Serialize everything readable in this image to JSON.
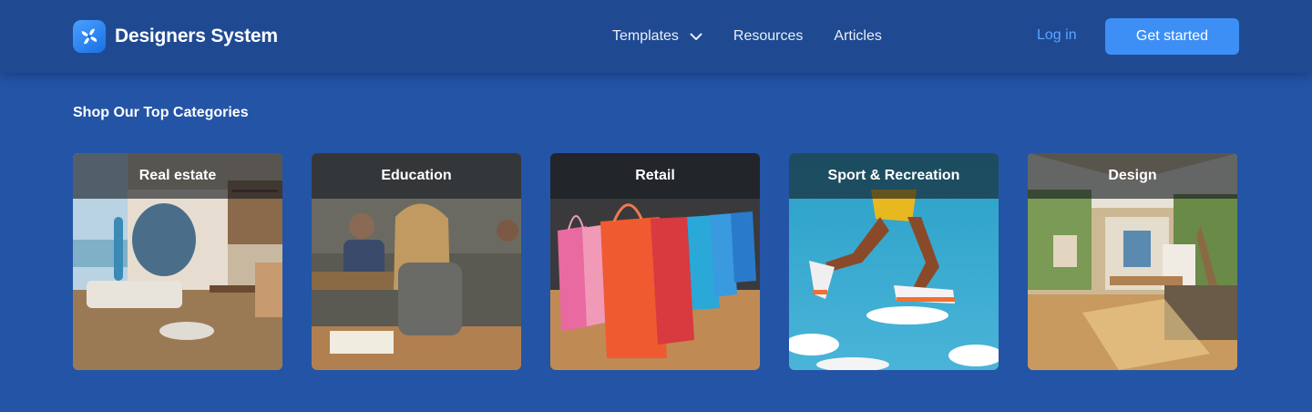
{
  "brand": {
    "name": "Designers System",
    "icon": "pinwheel-logo-icon"
  },
  "nav": {
    "links": [
      {
        "label": "Templates",
        "has_dropdown": true
      },
      {
        "label": "Resources"
      },
      {
        "label": "Articles"
      }
    ],
    "login_label": "Log in",
    "cta_label": "Get started"
  },
  "section": {
    "title": "Shop Our Top Categories"
  },
  "categories": [
    {
      "label": "Real estate"
    },
    {
      "label": "Education"
    },
    {
      "label": "Retail"
    },
    {
      "label": "Sport & Recreation"
    },
    {
      "label": "Design"
    }
  ],
  "colors": {
    "page_bg": "#2454a6",
    "nav_bg": "#1f4a92",
    "accent": "#3d8ff5",
    "link_accent": "#5aa6ff"
  }
}
